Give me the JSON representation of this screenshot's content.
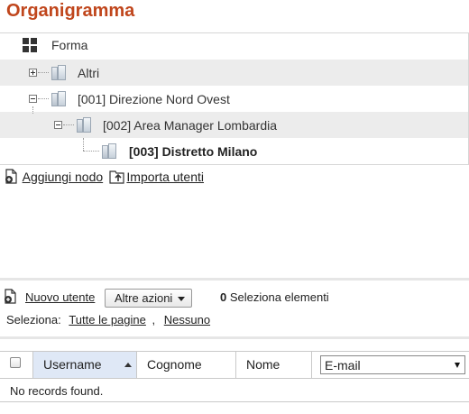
{
  "page": {
    "title": "Organigramma"
  },
  "tree": {
    "root_label": "Forma",
    "nodes": [
      {
        "label": "Altri",
        "expander": "plus"
      },
      {
        "label": "[001] Direzione Nord Ovest",
        "expander": "minus"
      },
      {
        "label": "[002] Area Manager Lombardia",
        "expander": "minus"
      },
      {
        "label": "[003] Distretto Milano",
        "expander": "none",
        "selected": true
      }
    ],
    "actions": {
      "add_node": "Aggiungi nodo",
      "import_users": "Importa utenti"
    }
  },
  "users": {
    "new_user": "Nuovo utente",
    "more_actions": "Altre azioni",
    "selected_count": "0",
    "selected_label": " Seleziona elementi",
    "select_prefix": "Seleziona:",
    "select_all_pages": "Tutte le pagine",
    "select_separator": ",",
    "select_none": "Nessuno"
  },
  "table": {
    "columns": [
      "Username",
      "Cognome",
      "Nome"
    ],
    "sorted_column": "Username",
    "sort_direction": "ascending",
    "extra_column_select": "E-mail",
    "empty_text": "No records found."
  },
  "colors": {
    "title": "#c0461c",
    "row_shade": "#ececec",
    "sorted_header": "#dfe8f6"
  }
}
